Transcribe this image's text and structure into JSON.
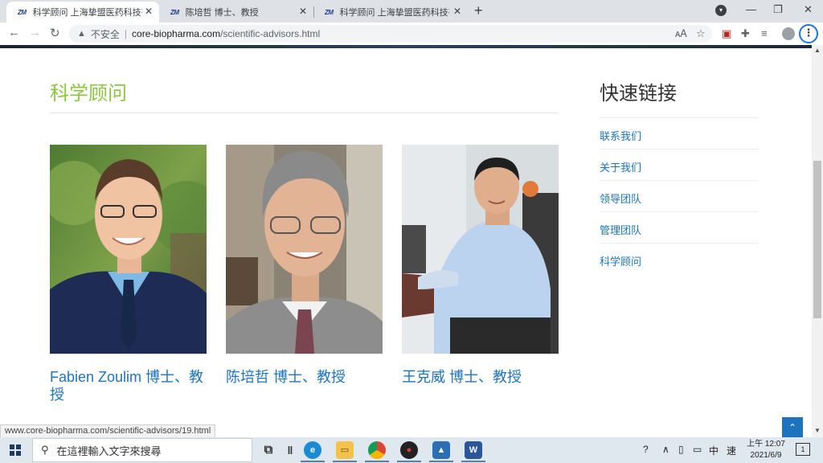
{
  "browser": {
    "tabs": [
      {
        "favicon": "ZM",
        "title": "科学顾问 上海挚盟医药科技有限",
        "active": true
      },
      {
        "favicon": "ZM",
        "title": "陈培哲 博士、教授",
        "active": false
      },
      {
        "favicon": "ZM",
        "title": "科学顾问 上海挚盟医药科技有限",
        "active": false
      }
    ],
    "new_tab": "+",
    "security_label": "不安全",
    "url_host": "core-biopharma.com",
    "url_path": "/scientific-advisors.html"
  },
  "page": {
    "section_title": "科学顾问",
    "advisors": [
      {
        "name": "Fabien Zoulim 博士、教授"
      },
      {
        "name": "陈培哲 博士、教授"
      },
      {
        "name": "王克威 博士、教授"
      }
    ],
    "sidebar": {
      "title": "快速链接",
      "links": [
        "联系我们",
        "关于我们",
        "领导团队",
        "管理团队",
        "科学顾问"
      ]
    },
    "back_to_top": "⌃"
  },
  "status_url": "www.core-biopharma.com/scientific-advisors/19.html",
  "taskbar": {
    "search_placeholder": "在這裡輸入文字來搜尋",
    "ime_lang": "中",
    "ime_mode": "速",
    "time": "上午 12:07",
    "date": "2021/6/9",
    "notification_count": "1"
  },
  "colors": {
    "accent_green": "#8cc63f",
    "link_blue": "#1e73be",
    "chrome_blue": "#1a73e8"
  }
}
